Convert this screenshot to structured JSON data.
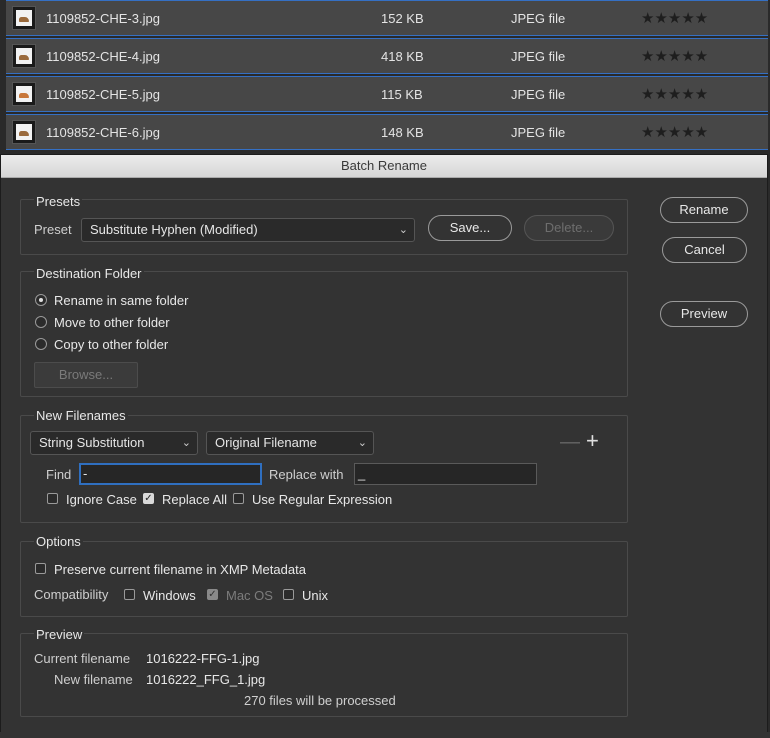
{
  "files": [
    {
      "name": "1109852-CHE-3.jpg",
      "size": "152 KB",
      "type": "JPEG file",
      "rating": "★★★★★"
    },
    {
      "name": "1109852-CHE-4.jpg",
      "size": "418 KB",
      "type": "JPEG file",
      "rating": "★★★★★"
    },
    {
      "name": "1109852-CHE-5.jpg",
      "size": "115 KB",
      "type": "JPEG file",
      "rating": "★★★★★"
    },
    {
      "name": "1109852-CHE-6.jpg",
      "size": "148 KB",
      "type": "JPEG file",
      "rating": "★★★★★"
    }
  ],
  "dialog": {
    "title": "Batch Rename",
    "buttons": {
      "rename": "Rename",
      "cancel": "Cancel",
      "preview": "Preview"
    },
    "presets": {
      "section_title": "Presets",
      "preset_label": "Preset",
      "preset_value": "Substitute Hyphen (Modified)",
      "save": "Save...",
      "delete": "Delete..."
    },
    "destination": {
      "section_title": "Destination Folder",
      "options": [
        "Rename in same folder",
        "Move to other folder",
        "Copy to other folder"
      ],
      "selected": 0,
      "browse": "Browse..."
    },
    "new_filenames": {
      "section_title": "New Filenames",
      "type_select": "String Substitution",
      "source_select": "Original Filename",
      "minus": "—",
      "plus": "+",
      "find_label": "Find",
      "find_value": "-",
      "replace_label": "Replace with",
      "replace_value": "_",
      "ignore_case": {
        "label": "Ignore Case",
        "checked": false
      },
      "replace_all": {
        "label": "Replace All",
        "checked": true
      },
      "regex": {
        "label": "Use Regular Expression",
        "checked": false
      }
    },
    "options": {
      "section_title": "Options",
      "preserve": {
        "label": "Preserve current filename in XMP Metadata",
        "checked": false
      },
      "compat_label": "Compatibility",
      "windows": {
        "label": "Windows",
        "checked": false
      },
      "macos": {
        "label": "Mac OS",
        "checked": true,
        "disabled": true
      },
      "unix": {
        "label": "Unix",
        "checked": false
      }
    },
    "preview": {
      "section_title": "Preview",
      "current_label": "Current filename",
      "current_value": "1016222-FFG-1.jpg",
      "new_label": "New filename",
      "new_value": "1016222_FFG_1.jpg",
      "summary": "270 files will be processed"
    }
  }
}
